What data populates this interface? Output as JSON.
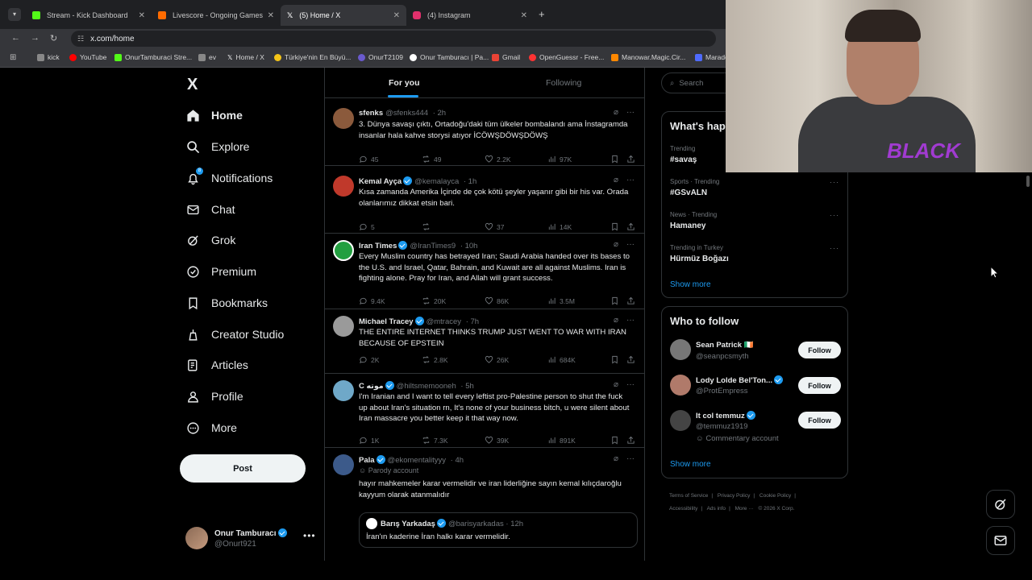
{
  "browser": {
    "tabs": [
      {
        "title": "Stream - Kick Dashboard",
        "icon": "kick-icon",
        "color": "#53fc18",
        "active": false
      },
      {
        "title": "Livescore - Ongoing Games an",
        "icon": "livescore-icon",
        "color": "#ff6b00",
        "active": false
      },
      {
        "title": "(5) Home / X",
        "icon": "x-icon",
        "color": "#ffffff",
        "active": true
      },
      {
        "title": "(4) Instagram",
        "icon": "instagram-icon",
        "color": "#e1306c",
        "active": false
      }
    ],
    "add_tab": "+",
    "url": "x.com/home",
    "bookmarks": [
      {
        "label": "kick",
        "color": "#888888"
      },
      {
        "label": "YouTube",
        "color": "#ff0000"
      },
      {
        "label": "OnurTamburaci Stre...",
        "color": "#53fc18"
      },
      {
        "label": "ev",
        "color": "#888888"
      },
      {
        "label": "Home / X",
        "color": "#ffffff"
      },
      {
        "label": "Türkiye'nin En Büyü...",
        "color": "#f5c518"
      },
      {
        "label": "OnurT2109",
        "color": "#6a5acd"
      },
      {
        "label": "Onur Tamburacı | Pa...",
        "color": "#ffffff"
      },
      {
        "label": "Gmail",
        "color": "#ea4335"
      },
      {
        "label": "OpenGuessr - Free...",
        "color": "#ff3333"
      },
      {
        "label": "Manowar.Magic.Cir...",
        "color": "#ff8800"
      },
      {
        "label": "Marado",
        "color": "#4f6bff"
      }
    ]
  },
  "webcam": {
    "shirt_text": "BLACK"
  },
  "nav": {
    "logo": "X",
    "items": [
      {
        "label": "Home",
        "icon": "home-icon",
        "bold": true
      },
      {
        "label": "Explore",
        "icon": "search-icon",
        "bold": false
      },
      {
        "label": "Notifications",
        "icon": "bell-icon",
        "bold": false,
        "badge": "8"
      },
      {
        "label": "Chat",
        "icon": "mail-icon",
        "bold": false
      },
      {
        "label": "Grok",
        "icon": "grok-icon",
        "bold": false
      },
      {
        "label": "Premium",
        "icon": "premium-icon",
        "bold": false
      },
      {
        "label": "Bookmarks",
        "icon": "bookmark-icon",
        "bold": false
      },
      {
        "label": "Creator Studio",
        "icon": "creator-studio-icon",
        "bold": false
      },
      {
        "label": "Articles",
        "icon": "articles-icon",
        "bold": false
      },
      {
        "label": "Profile",
        "icon": "profile-icon",
        "bold": false
      },
      {
        "label": "More",
        "icon": "more-circle-icon",
        "bold": false
      }
    ],
    "post_label": "Post",
    "me": {
      "name": "Onur Tamburacı",
      "handle": "@Onurt921",
      "more": "•••"
    }
  },
  "feed": {
    "tabs": [
      "For you",
      "Following"
    ],
    "tweets": [
      {
        "name": "sfenks",
        "verified": false,
        "handle": "@sfenks444",
        "time": "· 2h",
        "text": "3. Dünya savaşı çıktı, Ortadoğu'daki tüm ülkeler bombalandı ama İnstagramda insanlar hala kahve storysi atıyor İCÖWŞDÖWŞDÖWŞ",
        "replies": "45",
        "reposts": "49",
        "likes": "2.2K",
        "views": "97K",
        "avatar_color": "#8b5a3c"
      },
      {
        "name": "Kemal Ayça",
        "verified": true,
        "handle": "@kemalayca",
        "time": "· 1h",
        "text": "Kısa zamanda Amerika İçinde de çok kötü şeyler yaşanır gibi bir his var. Orada olanlarımız dikkat etsin bari.",
        "replies": "5",
        "reposts": "",
        "likes": "37",
        "views": "14K",
        "avatar_color": "#c0392b"
      },
      {
        "name": "Iran Times",
        "verified": true,
        "handle": "@IranTimes9",
        "time": "· 10h",
        "text": "Every Muslim country has betrayed Iran; Saudi Arabia handed over its bases to the U.S. and Israel, Qatar, Bahrain, and Kuwait are all against Muslims. Iran is fighting alone. Pray for Iran, and Allah will grant success.",
        "replies": "9.4K",
        "reposts": "20K",
        "likes": "86K",
        "views": "3.5M",
        "avatar_color": "#239f40"
      },
      {
        "name": "Michael Tracey",
        "verified": true,
        "handle": "@mtracey",
        "time": "· 7h",
        "text": "THE ENTIRE INTERNET THINKS TRUMP JUST WENT TO WAR WITH IRAN BECAUSE OF EPSTEIN",
        "replies": "2K",
        "reposts": "2.8K",
        "likes": "26K",
        "views": "684K",
        "avatar_color": "#9a9a9a"
      },
      {
        "name": "C موته",
        "verified": true,
        "handle": "@hiltsmemooneh",
        "time": "· 5h",
        "text": "I'm Iranian and I want to tell every leftist pro-Palestine person to shut the fuck up about Iran's situation rn, It's none of your business bitch, u were silent about Iran massacre you better keep it that way now.",
        "replies": "1K",
        "reposts": "7.3K",
        "likes": "39K",
        "views": "891K",
        "avatar_color": "#6fa8c8"
      },
      {
        "name": "Pala",
        "verified": true,
        "handle": "@ekomentalityyy",
        "time": "· 4h",
        "sublabel": "Parody account",
        "text": "hayır mahkemeler karar vermelidir ve iran liderliğine sayın kemal kılıçdaroğlu kayyum olarak atanmalıdır",
        "avatar_color": "#3c5a8a",
        "quote": {
          "name": "Barış Yarkadaş",
          "handle": "@barisyarkadas",
          "time": "· 12h",
          "text": "İran'ın kaderine İran halkı karar vermelidir."
        }
      }
    ]
  },
  "right": {
    "search_placeholder": "Search",
    "trends_title": "What's hap",
    "trends": [
      {
        "context": "Trending",
        "title": "#savaş"
      },
      {
        "context": "Sports · Trending",
        "title": "#GSvALN"
      },
      {
        "context": "News · Trending",
        "title": "Hamaney"
      },
      {
        "context": "Trending in Turkey",
        "title": "Hürmüz Boğazı"
      }
    ],
    "trend_more": "···",
    "show_more": "Show more",
    "wtf_title": "Who to follow",
    "follow_label": "Follow",
    "wtf": [
      {
        "name": "Sean Patrick 🇮🇪",
        "handle": "@seanpcsmyth",
        "verified": false,
        "color": "#777777"
      },
      {
        "name": "Lody Lolde Bel'Ton...",
        "handle": "@ProtEmpress",
        "verified": true,
        "color": "#b07a6a"
      },
      {
        "name": "It col temmuz",
        "handle": "@temmuz1919",
        "verified": true,
        "color": "#444444",
        "sub": "Commentary account"
      }
    ],
    "footer": [
      "Terms of Service",
      "|",
      "Privacy Policy",
      "|",
      "Cookie Policy",
      "|",
      "Accessibility",
      "|",
      "Ads info",
      "|",
      "More ···",
      "© 2026 X Corp."
    ]
  }
}
